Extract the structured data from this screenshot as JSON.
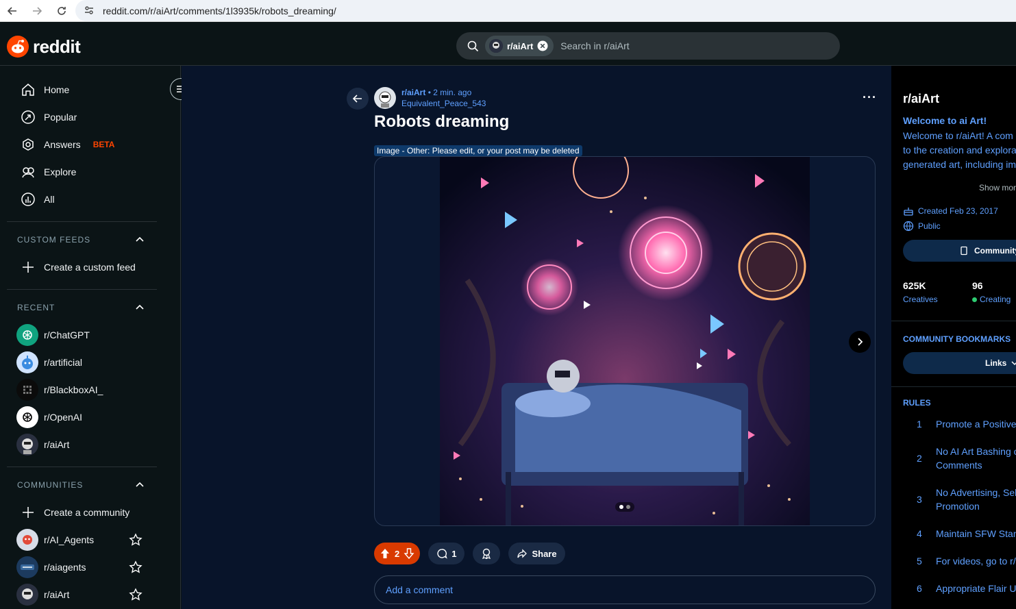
{
  "browser": {
    "url": "reddit.com/r/aiArt/comments/1l3935k/robots_dreaming/"
  },
  "header": {
    "logo_text": "reddit",
    "search_chip": "r/aiArt",
    "search_placeholder": "Search in r/aiArt"
  },
  "sidebar": {
    "nav": [
      {
        "label": "Home",
        "icon": "home-icon"
      },
      {
        "label": "Popular",
        "icon": "popular-icon"
      },
      {
        "label": "Answers",
        "icon": "answers-icon",
        "badge": "BETA"
      },
      {
        "label": "Explore",
        "icon": "explore-icon"
      },
      {
        "label": "All",
        "icon": "all-icon"
      }
    ],
    "custom_feeds": {
      "heading": "CUSTOM FEEDS",
      "create": "Create a custom feed"
    },
    "recent": {
      "heading": "RECENT",
      "items": [
        "r/ChatGPT",
        "r/artificial",
        "r/BlackboxAI_",
        "r/OpenAI",
        "r/aiArt"
      ]
    },
    "communities": {
      "heading": "COMMUNITIES",
      "create": "Create a community",
      "items": [
        "r/AI_Agents",
        "r/aiagents",
        "r/aiArt"
      ]
    }
  },
  "post": {
    "subreddit": "r/aiArt",
    "time": "• 2 min. ago",
    "author": "Equivalent_Peace_543",
    "title": "Robots dreaming",
    "flair": "Image - Other: Please edit, or your post may be deleted",
    "votes": "2",
    "comments": "1",
    "share_label": "Share",
    "comment_placeholder": "Add a comment"
  },
  "community": {
    "name": "r/aiArt",
    "welcome_title": "Welcome to ai Art!",
    "desc_lines": [
      "Welcome to r/aiArt! A com",
      "to the creation and explora",
      "generated art, including im"
    ],
    "show_more": "Show mor",
    "created": "Created Feb 23, 2017",
    "visibility": "Public",
    "guide_label": "Community",
    "members": "625K",
    "members_label": "Creatives",
    "online": "96",
    "online_label": "Creating",
    "bookmarks_heading": "COMMUNITY BOOKMARKS",
    "links_label": "Links",
    "rules_heading": "RULES",
    "rules": [
      {
        "n": "1",
        "lines": [
          "Promote a Positive"
        ]
      },
      {
        "n": "2",
        "lines": [
          "No AI Art Bashing o",
          "Comments"
        ]
      },
      {
        "n": "3",
        "lines": [
          "No Advertising, Sel",
          "Promotion"
        ]
      },
      {
        "n": "4",
        "lines": [
          "Maintain SFW Stan"
        ]
      },
      {
        "n": "5",
        "lines": [
          "For videos, go to r/"
        ]
      },
      {
        "n": "6",
        "lines": [
          "Appropriate Flair U"
        ]
      }
    ]
  },
  "colors": {
    "accent": "#ff4500",
    "link": "#5fa0ff",
    "upvote_bg": "#d93a00"
  }
}
